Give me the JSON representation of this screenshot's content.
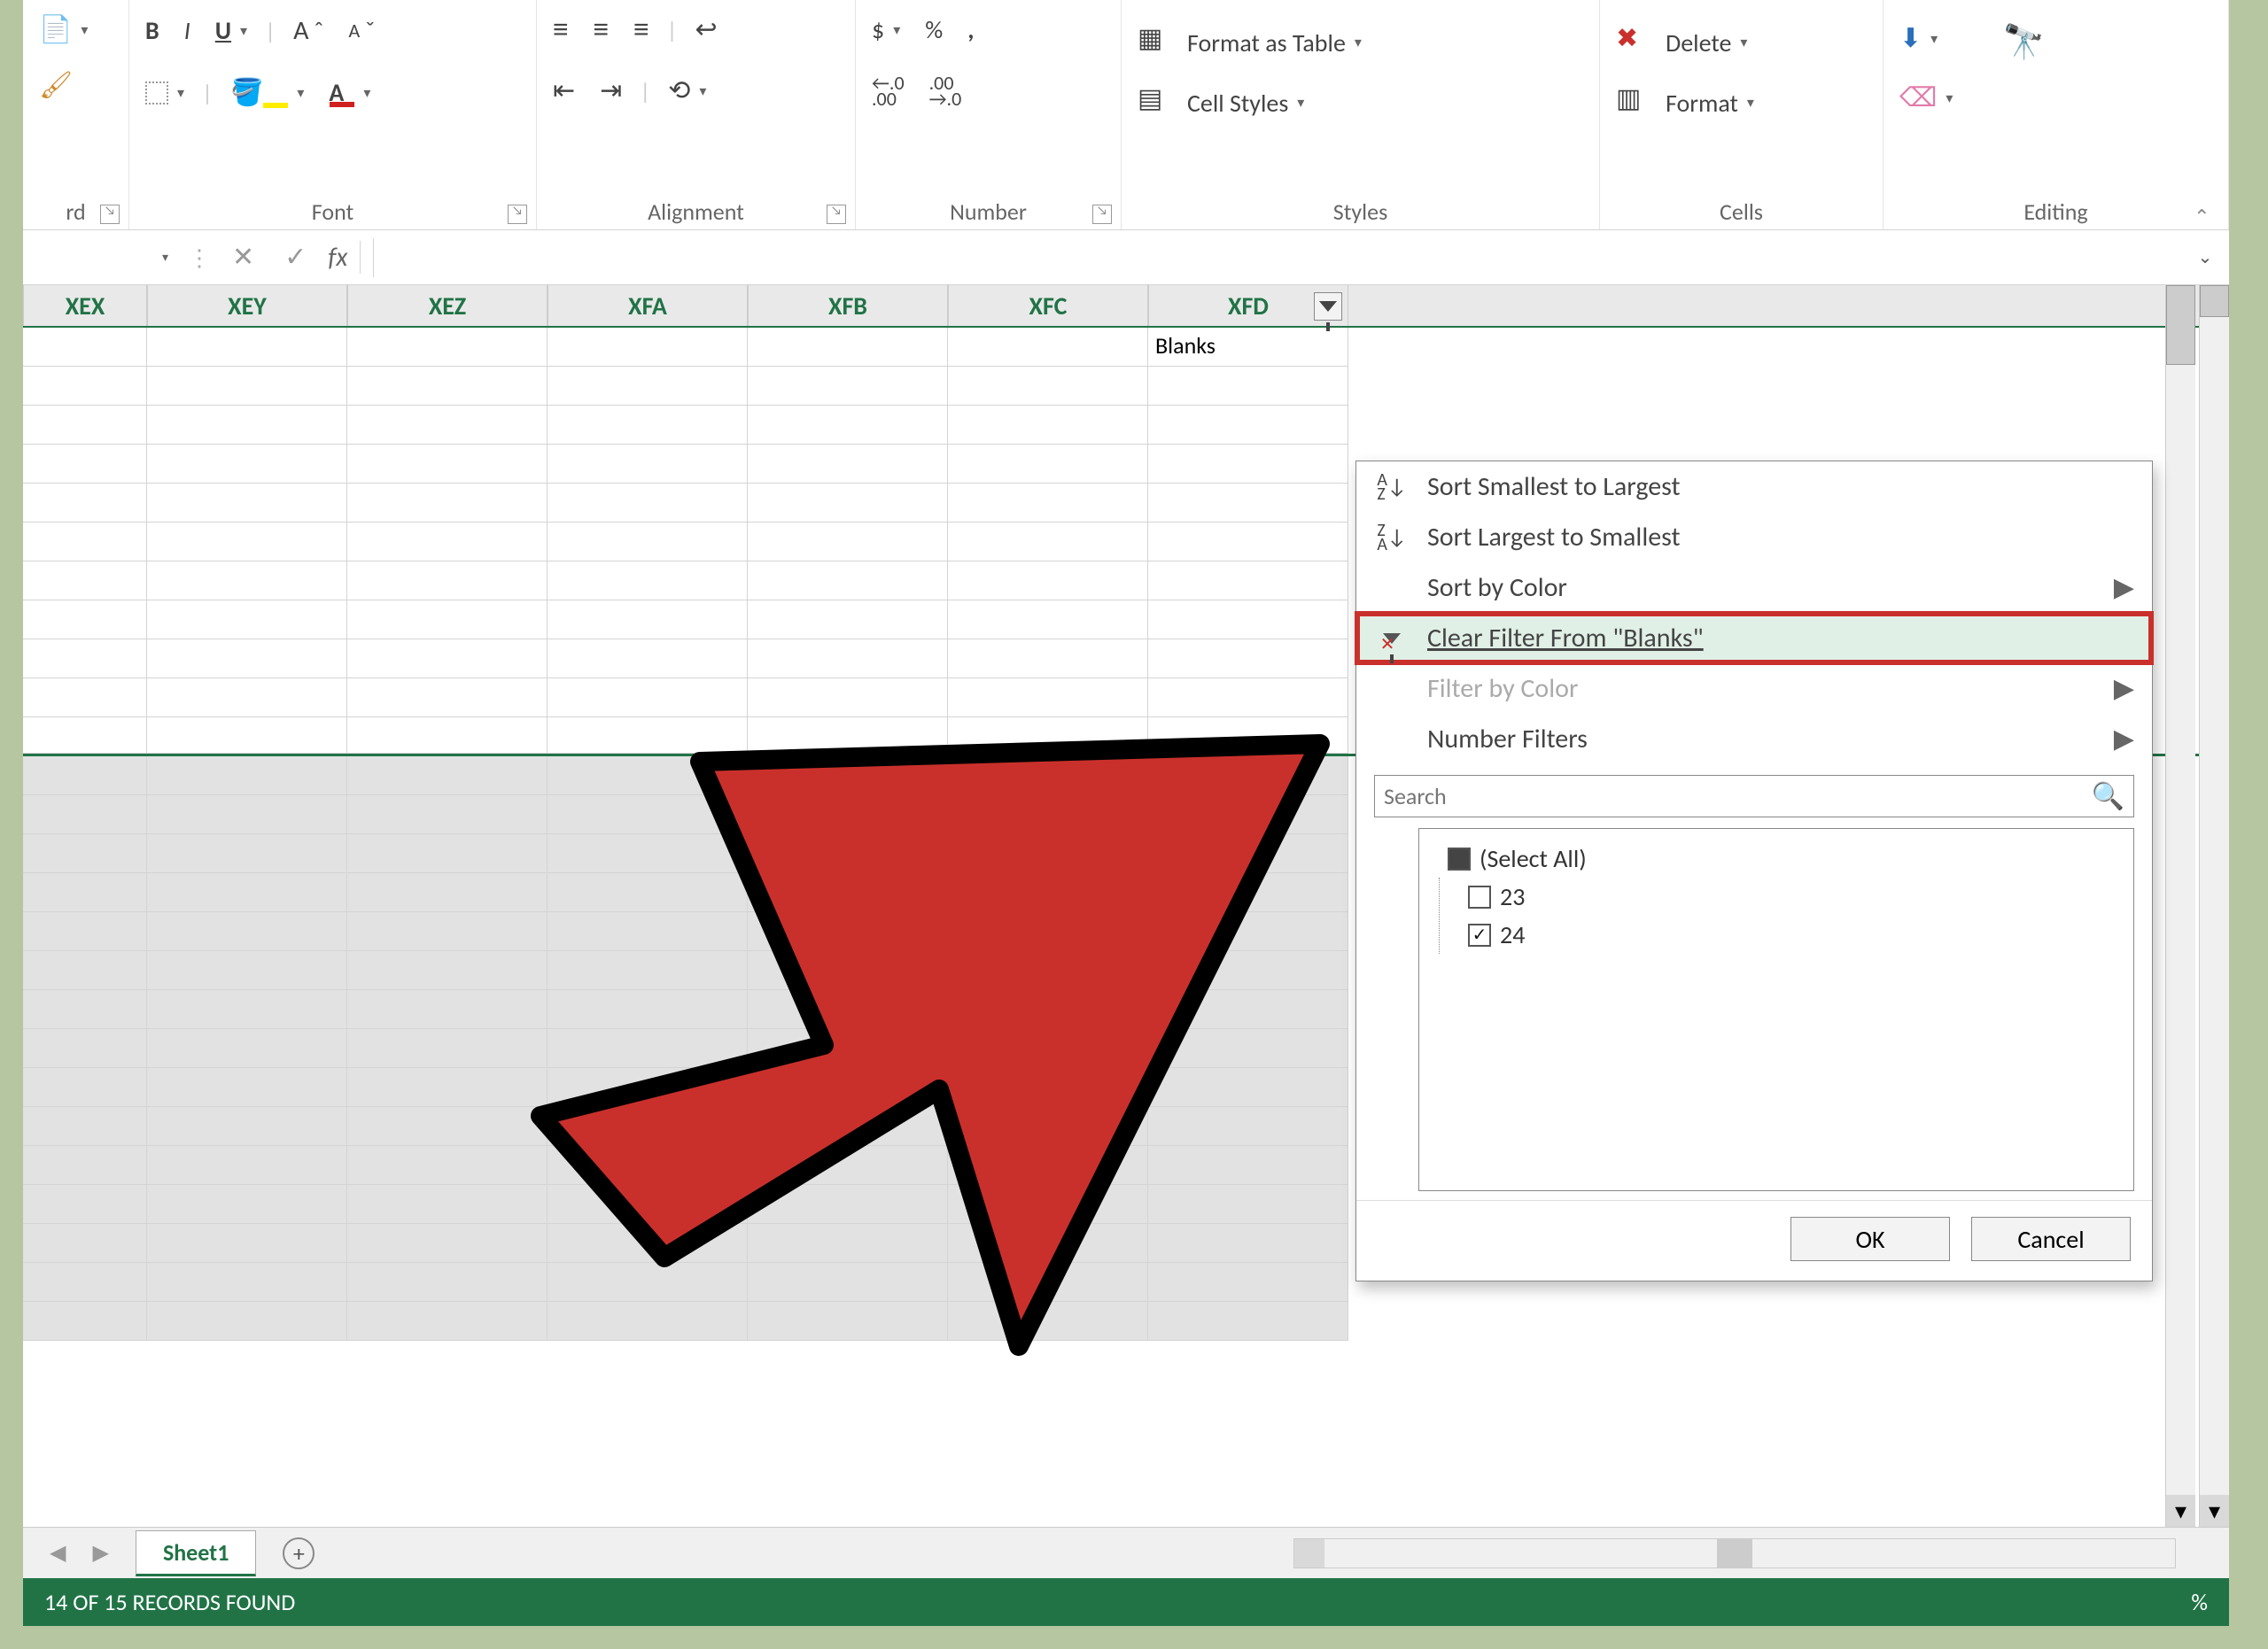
{
  "ribbon": {
    "groups": {
      "font": {
        "label": "Font",
        "bold": "B",
        "italic": "I",
        "underline": "U",
        "increase_font": "A",
        "decrease_font": "A"
      },
      "alignment": {
        "label": "Alignment",
        "wrap_text": "",
        "merge_center": ""
      },
      "number": {
        "label": "Number",
        "currency": "$",
        "percent": "%",
        "comma": ",",
        "inc_dec": ".0",
        "dec_dec": ".00",
        "inc_dec2": ".00",
        "dec_dec2": "→.0"
      },
      "styles": {
        "label": "Styles",
        "format_table": "Format as Table",
        "cell_styles": "Cell Styles"
      },
      "cells": {
        "label": "Cells",
        "delete": "Delete",
        "format": "Format"
      },
      "editing": {
        "label": "Editing",
        "fill": "",
        "find": ""
      }
    }
  },
  "formula_bar": {
    "cancel": "✕",
    "enter": "✓",
    "fx": "fx"
  },
  "columns": [
    "XEX",
    "XEY",
    "XEZ",
    "XFA",
    "XFB",
    "XFC",
    "XFD"
  ],
  "active_cell_label": "Blanks",
  "sheet_tab": "Sheet1",
  "status_text": "14 OF 15 RECORDS FOUND",
  "zoom": "%",
  "filter_menu": {
    "sort_asc": "Sort Smallest to Largest",
    "sort_desc": "Sort Largest to Smallest",
    "sort_color": "Sort by Color",
    "clear_filter": "Clear Filter From \"Blanks\"",
    "filter_color": "Filter by Color",
    "number_filters": "Number Filters",
    "search_placeholder": "Search",
    "select_all": "(Select All)",
    "items": [
      "23",
      "24"
    ],
    "ok": "OK",
    "cancel": "Cancel"
  }
}
